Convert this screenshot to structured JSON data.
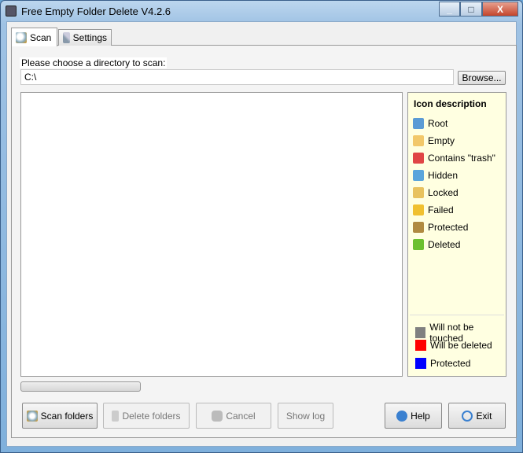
{
  "window": {
    "title": "Free Empty Folder Delete V4.2.6",
    "minimize": "_",
    "maximize": "□",
    "close": "X"
  },
  "tabs": [
    {
      "label": "Scan",
      "icon": "magnifier-icon"
    },
    {
      "label": "Settings",
      "icon": "tools-icon"
    }
  ],
  "scan": {
    "dir_label": "Please choose a directory to scan:",
    "dir_value": "C:\\",
    "browse": "Browse..."
  },
  "legend": {
    "title": "Icon description",
    "items": [
      {
        "label": "Root",
        "color": "#5b9bd5"
      },
      {
        "label": "Empty",
        "color": "#f2c86a"
      },
      {
        "label": "Contains \"trash\"",
        "color": "#e04545"
      },
      {
        "label": "Hidden",
        "color": "#5aa5dc"
      },
      {
        "label": "Locked",
        "color": "#e8c25e"
      },
      {
        "label": "Failed",
        "color": "#f0c030"
      },
      {
        "label": "Protected",
        "color": "#b08a40"
      },
      {
        "label": "Deleted",
        "color": "#6cc030"
      }
    ],
    "swatches": [
      {
        "label": "Will not be touched",
        "color": "#808080"
      },
      {
        "label": "Will be deleted",
        "color": "#ff0000"
      },
      {
        "label": "Protected",
        "color": "#0000ff"
      }
    ]
  },
  "progress": 0,
  "buttons": {
    "scan": "Scan folders",
    "delete": "Delete folders",
    "cancel": "Cancel",
    "log": "Show log",
    "help": "Help",
    "exit": "Exit"
  }
}
